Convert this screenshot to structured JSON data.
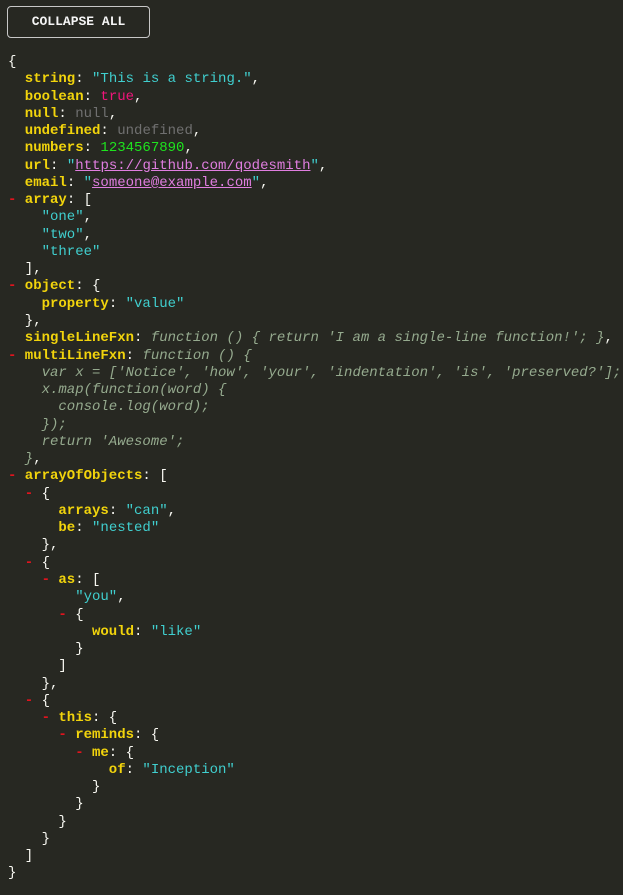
{
  "toolbar": {
    "collapse_all_label": "COLLAPSE ALL"
  },
  "colors": {
    "background": "#272822",
    "key": "#f2d40c",
    "string": "#40cfcf",
    "boolean": "#f0157b",
    "null": "#707070",
    "number": "#1ee41e",
    "link": "#e07ee0",
    "function": "#95aa8e",
    "toggle_marker": "#e0141e"
  },
  "icons": {
    "collapse_toggle": "minus-icon",
    "collapse_glyph": "-"
  },
  "lines": [
    {
      "depth": 0,
      "toggle": false,
      "parts": [
        {
          "t": "punc",
          "v": "{"
        }
      ]
    },
    {
      "depth": 1,
      "toggle": false,
      "parts": [
        {
          "t": "key",
          "v": "string"
        },
        {
          "t": "punc",
          "v": ": "
        },
        {
          "t": "str",
          "v": "\"This is a string.\""
        },
        {
          "t": "punc",
          "v": ","
        }
      ]
    },
    {
      "depth": 1,
      "toggle": false,
      "parts": [
        {
          "t": "key",
          "v": "boolean"
        },
        {
          "t": "punc",
          "v": ": "
        },
        {
          "t": "bool",
          "v": "true"
        },
        {
          "t": "punc",
          "v": ","
        }
      ]
    },
    {
      "depth": 1,
      "toggle": false,
      "parts": [
        {
          "t": "key",
          "v": "null"
        },
        {
          "t": "punc",
          "v": ": "
        },
        {
          "t": "null",
          "v": "null"
        },
        {
          "t": "punc",
          "v": ","
        }
      ]
    },
    {
      "depth": 1,
      "toggle": false,
      "parts": [
        {
          "t": "key",
          "v": "undefined"
        },
        {
          "t": "punc",
          "v": ": "
        },
        {
          "t": "null",
          "v": "undefined"
        },
        {
          "t": "punc",
          "v": ","
        }
      ]
    },
    {
      "depth": 1,
      "toggle": false,
      "parts": [
        {
          "t": "key",
          "v": "numbers"
        },
        {
          "t": "punc",
          "v": ": "
        },
        {
          "t": "num",
          "v": "1234567890"
        },
        {
          "t": "punc",
          "v": ","
        }
      ]
    },
    {
      "depth": 1,
      "toggle": false,
      "parts": [
        {
          "t": "key",
          "v": "url"
        },
        {
          "t": "punc",
          "v": ": "
        },
        {
          "t": "str",
          "v": "\""
        },
        {
          "t": "link",
          "v": "https://github.com/qodesmith"
        },
        {
          "t": "str",
          "v": "\""
        },
        {
          "t": "punc",
          "v": ","
        }
      ]
    },
    {
      "depth": 1,
      "toggle": false,
      "parts": [
        {
          "t": "key",
          "v": "email"
        },
        {
          "t": "punc",
          "v": ": "
        },
        {
          "t": "str",
          "v": "\""
        },
        {
          "t": "link",
          "v": "someone@example.com"
        },
        {
          "t": "str",
          "v": "\""
        },
        {
          "t": "punc",
          "v": ","
        }
      ]
    },
    {
      "depth": 1,
      "toggle": true,
      "parts": [
        {
          "t": "key",
          "v": "array"
        },
        {
          "t": "punc",
          "v": ": ["
        }
      ]
    },
    {
      "depth": 2,
      "toggle": false,
      "parts": [
        {
          "t": "str",
          "v": "\"one\""
        },
        {
          "t": "punc",
          "v": ","
        }
      ]
    },
    {
      "depth": 2,
      "toggle": false,
      "parts": [
        {
          "t": "str",
          "v": "\"two\""
        },
        {
          "t": "punc",
          "v": ","
        }
      ]
    },
    {
      "depth": 2,
      "toggle": false,
      "parts": [
        {
          "t": "str",
          "v": "\"three\""
        }
      ]
    },
    {
      "depth": 1,
      "toggle": false,
      "parts": [
        {
          "t": "punc",
          "v": "],"
        }
      ]
    },
    {
      "depth": 1,
      "toggle": true,
      "parts": [
        {
          "t": "key",
          "v": "object"
        },
        {
          "t": "punc",
          "v": ": {"
        }
      ]
    },
    {
      "depth": 2,
      "toggle": false,
      "parts": [
        {
          "t": "key",
          "v": "property"
        },
        {
          "t": "punc",
          "v": ": "
        },
        {
          "t": "str",
          "v": "\"value\""
        }
      ]
    },
    {
      "depth": 1,
      "toggle": false,
      "parts": [
        {
          "t": "punc",
          "v": "},"
        }
      ]
    },
    {
      "depth": 1,
      "toggle": false,
      "parts": [
        {
          "t": "key",
          "v": "singleLineFxn"
        },
        {
          "t": "punc",
          "v": ": "
        },
        {
          "t": "fn",
          "v": "function () { return 'I am a single-line function!'; }"
        },
        {
          "t": "punc",
          "v": ","
        }
      ]
    },
    {
      "depth": 1,
      "toggle": true,
      "parts": [
        {
          "t": "key",
          "v": "multiLineFxn"
        },
        {
          "t": "punc",
          "v": ": "
        },
        {
          "t": "fn",
          "v": "function () {"
        }
      ]
    },
    {
      "depth": 2,
      "toggle": false,
      "parts": [
        {
          "t": "fn",
          "v": "var x = ['Notice', 'how', 'your', 'indentation', 'is', 'preserved?'];"
        }
      ]
    },
    {
      "depth": 2,
      "toggle": false,
      "parts": [
        {
          "t": "fn",
          "v": "x.map(function(word) {"
        }
      ]
    },
    {
      "depth": 3,
      "toggle": false,
      "parts": [
        {
          "t": "fn",
          "v": "console.log(word);"
        }
      ]
    },
    {
      "depth": 2,
      "toggle": false,
      "parts": [
        {
          "t": "fn",
          "v": "});"
        }
      ]
    },
    {
      "depth": 2,
      "toggle": false,
      "parts": [
        {
          "t": "fn",
          "v": "return 'Awesome';"
        }
      ]
    },
    {
      "depth": 1,
      "toggle": false,
      "parts": [
        {
          "t": "fn",
          "v": "}"
        },
        {
          "t": "punc",
          "v": ","
        }
      ]
    },
    {
      "depth": 1,
      "toggle": true,
      "parts": [
        {
          "t": "key",
          "v": "arrayOfObjects"
        },
        {
          "t": "punc",
          "v": ": ["
        }
      ]
    },
    {
      "depth": 2,
      "toggle": true,
      "parts": [
        {
          "t": "punc",
          "v": "{"
        }
      ]
    },
    {
      "depth": 3,
      "toggle": false,
      "parts": [
        {
          "t": "key",
          "v": "arrays"
        },
        {
          "t": "punc",
          "v": ": "
        },
        {
          "t": "str",
          "v": "\"can\""
        },
        {
          "t": "punc",
          "v": ","
        }
      ]
    },
    {
      "depth": 3,
      "toggle": false,
      "parts": [
        {
          "t": "key",
          "v": "be"
        },
        {
          "t": "punc",
          "v": ": "
        },
        {
          "t": "str",
          "v": "\"nested\""
        }
      ]
    },
    {
      "depth": 2,
      "toggle": false,
      "parts": [
        {
          "t": "punc",
          "v": "},"
        }
      ]
    },
    {
      "depth": 2,
      "toggle": true,
      "parts": [
        {
          "t": "punc",
          "v": "{"
        }
      ]
    },
    {
      "depth": 3,
      "toggle": true,
      "parts": [
        {
          "t": "key",
          "v": "as"
        },
        {
          "t": "punc",
          "v": ": ["
        }
      ]
    },
    {
      "depth": 4,
      "toggle": false,
      "parts": [
        {
          "t": "str",
          "v": "\"you\""
        },
        {
          "t": "punc",
          "v": ","
        }
      ]
    },
    {
      "depth": 4,
      "toggle": true,
      "parts": [
        {
          "t": "punc",
          "v": "{"
        }
      ]
    },
    {
      "depth": 5,
      "toggle": false,
      "parts": [
        {
          "t": "key",
          "v": "would"
        },
        {
          "t": "punc",
          "v": ": "
        },
        {
          "t": "str",
          "v": "\"like\""
        }
      ]
    },
    {
      "depth": 4,
      "toggle": false,
      "parts": [
        {
          "t": "punc",
          "v": "}"
        }
      ]
    },
    {
      "depth": 3,
      "toggle": false,
      "parts": [
        {
          "t": "punc",
          "v": "]"
        }
      ]
    },
    {
      "depth": 2,
      "toggle": false,
      "parts": [
        {
          "t": "punc",
          "v": "},"
        }
      ]
    },
    {
      "depth": 2,
      "toggle": true,
      "parts": [
        {
          "t": "punc",
          "v": "{"
        }
      ]
    },
    {
      "depth": 3,
      "toggle": true,
      "parts": [
        {
          "t": "key",
          "v": "this"
        },
        {
          "t": "punc",
          "v": ": {"
        }
      ]
    },
    {
      "depth": 4,
      "toggle": true,
      "parts": [
        {
          "t": "key",
          "v": "reminds"
        },
        {
          "t": "punc",
          "v": ": {"
        }
      ]
    },
    {
      "depth": 5,
      "toggle": true,
      "parts": [
        {
          "t": "key",
          "v": "me"
        },
        {
          "t": "punc",
          "v": ": {"
        }
      ]
    },
    {
      "depth": 6,
      "toggle": false,
      "parts": [
        {
          "t": "key",
          "v": "of"
        },
        {
          "t": "punc",
          "v": ": "
        },
        {
          "t": "str",
          "v": "\"Inception\""
        }
      ]
    },
    {
      "depth": 5,
      "toggle": false,
      "parts": [
        {
          "t": "punc",
          "v": "}"
        }
      ]
    },
    {
      "depth": 4,
      "toggle": false,
      "parts": [
        {
          "t": "punc",
          "v": "}"
        }
      ]
    },
    {
      "depth": 3,
      "toggle": false,
      "parts": [
        {
          "t": "punc",
          "v": "}"
        }
      ]
    },
    {
      "depth": 2,
      "toggle": false,
      "parts": [
        {
          "t": "punc",
          "v": "}"
        }
      ]
    },
    {
      "depth": 1,
      "toggle": false,
      "parts": [
        {
          "t": "punc",
          "v": "]"
        }
      ]
    },
    {
      "depth": 0,
      "toggle": false,
      "parts": [
        {
          "t": "punc",
          "v": "}"
        }
      ]
    }
  ]
}
